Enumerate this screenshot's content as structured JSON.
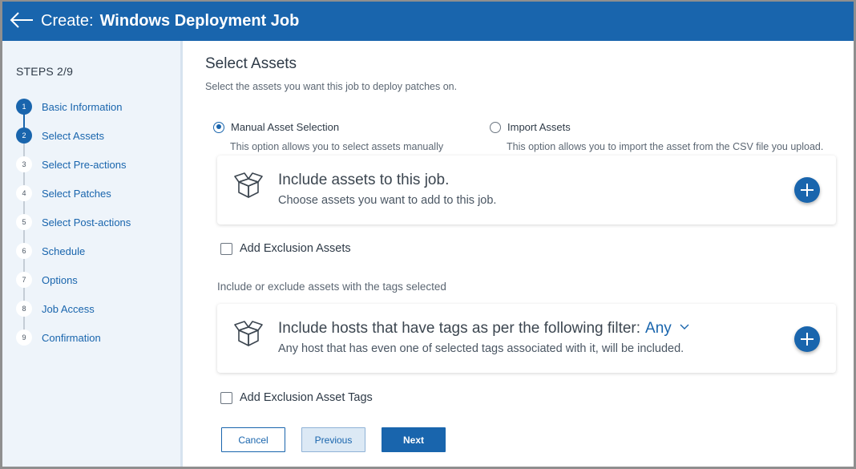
{
  "header": {
    "back_icon": "arrow-left-icon",
    "prefix": "Create:",
    "job_name": "Windows Deployment Job",
    "color": "#1965ad"
  },
  "sidebar": {
    "steps_label": "STEPS 2/9",
    "current_step": 2,
    "steps": [
      {
        "num": "1",
        "label": "Basic Information",
        "done": true
      },
      {
        "num": "2",
        "label": "Select Assets",
        "done": true
      },
      {
        "num": "3",
        "label": "Select Pre-actions",
        "done": false
      },
      {
        "num": "4",
        "label": "Select Patches",
        "done": false
      },
      {
        "num": "5",
        "label": "Select Post-actions",
        "done": false
      },
      {
        "num": "6",
        "label": "Schedule",
        "done": false
      },
      {
        "num": "7",
        "label": "Options",
        "done": false
      },
      {
        "num": "8",
        "label": "Job Access",
        "done": false
      },
      {
        "num": "9",
        "label": "Confirmation",
        "done": false
      }
    ]
  },
  "main": {
    "title": "Select Assets",
    "subtitle": "Select the assets you want this job to deploy patches on.",
    "options": [
      {
        "label": "Manual Asset Selection",
        "desc": "This option allows you to select assets manually",
        "selected": true
      },
      {
        "label": "Import Assets",
        "desc": "This option allows you to import the asset from the CSV file you upload.",
        "selected": false
      }
    ],
    "assets_card": {
      "icon": "open-box-icon",
      "title": "Include assets to this job.",
      "subtitle": "Choose assets you want to add to this job."
    },
    "exclusion_assets_label": "Add Exclusion Assets",
    "tags_hint": "Include or exclude assets with the tags selected",
    "tags_card": {
      "icon": "open-box-icon",
      "title": "Include hosts that have tags as per the following filter:",
      "filter_value": "Any",
      "subtitle": "Any host that has even one of selected tags associated with it, will be included."
    },
    "exclusion_tags_label": "Add Exclusion Asset Tags"
  },
  "footer": {
    "cancel": "Cancel",
    "previous": "Previous",
    "next": "Next"
  }
}
